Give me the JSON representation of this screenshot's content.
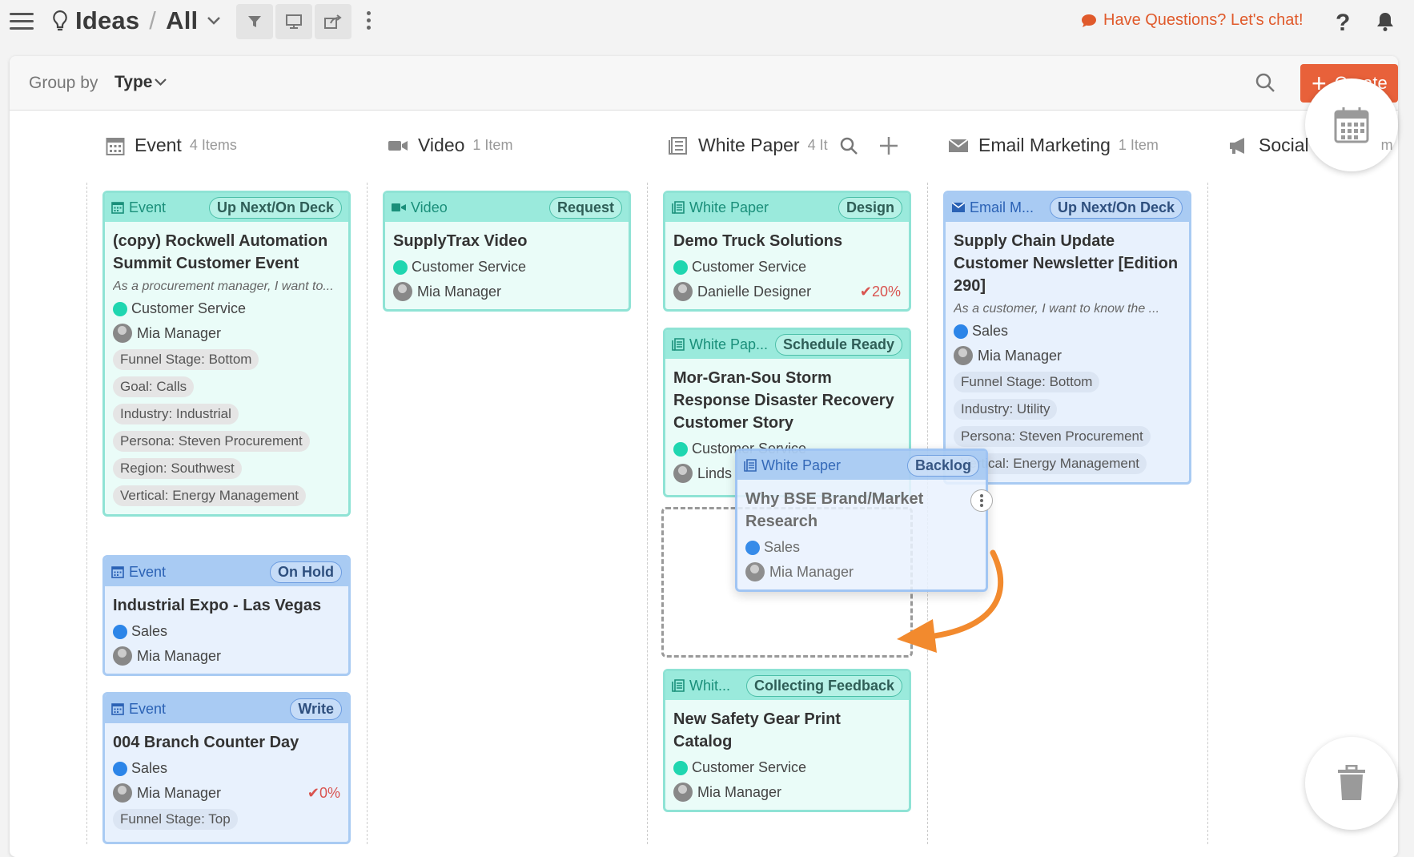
{
  "header": {
    "title": "Ideas",
    "separator": "/",
    "view": "All",
    "chat": "Have Questions? Let's chat!",
    "help": "?"
  },
  "groupbar": {
    "label": "Group by",
    "value": "Type",
    "create": "Create"
  },
  "columns": [
    {
      "name": "Event",
      "count": "4 Items"
    },
    {
      "name": "Video",
      "count": "1 Item"
    },
    {
      "name": "White Paper",
      "count": "4 It"
    },
    {
      "name": "Email Marketing",
      "count": "1 Item"
    },
    {
      "name": "Social",
      "count": "m"
    }
  ],
  "cards": {
    "e1": {
      "type": "Event",
      "status": "Up Next/On Deck",
      "title": "(copy) Rockwell Automation Summit Customer Event",
      "desc": "As a procurement manager, I want to...",
      "tag": "Customer Service",
      "owner": "Mia Manager",
      "chips": [
        "Funnel Stage: Bottom",
        "Goal: Calls",
        "Industry: Industrial",
        "Persona: Steven Procurement",
        "Region: Southwest",
        "Vertical: Energy Management"
      ]
    },
    "e2": {
      "type": "Event",
      "status": "On Hold",
      "title": "Industrial Expo - Las Vegas",
      "tag": "Sales",
      "owner": "Mia Manager"
    },
    "e3": {
      "type": "Event",
      "status": "Write",
      "title": "004 Branch Counter Day",
      "tag": "Sales",
      "owner": "Mia Manager",
      "pct": "0%",
      "chips": [
        "Funnel Stage: Top"
      ]
    },
    "v1": {
      "type": "Video",
      "status": "Request",
      "title": "SupplyTrax Video",
      "tag": "Customer Service",
      "owner": "Mia Manager"
    },
    "w1": {
      "type": "White Paper",
      "status": "Design",
      "title": "Demo Truck Solutions",
      "tag": "Customer Service",
      "owner": "Danielle Designer",
      "pct": "20%"
    },
    "w2": {
      "type": "White Pap...",
      "status": "Schedule Ready",
      "title": "Mor-Gran-Sou Storm Response Disaster Recovery Customer Story",
      "tag": "Customer Service",
      "owner": "Linds"
    },
    "w3": {
      "type": "Whit...",
      "status": "Collecting Feedback",
      "title": "New Safety Gear Print Catalog",
      "tag": "Customer Service",
      "owner": "Mia Manager"
    },
    "m1": {
      "type": "Email M...",
      "status": "Up Next/On Deck",
      "title": "Supply Chain Update Customer Newsletter [Edition 290]",
      "desc": "As a customer, I want to know the ...",
      "tag": "Sales",
      "owner": "Mia Manager",
      "chips": [
        "Funnel Stage: Bottom",
        "Industry: Utility",
        "Persona: Steven Procurement",
        "Vertical: Energy Management"
      ]
    },
    "drag": {
      "type": "White Paper",
      "status": "Backlog",
      "title": "Why BSE Brand/Market Research",
      "tag": "Sales",
      "owner": "Mia Manager"
    }
  },
  "colors": {
    "accent": "#e8613a",
    "teal": "#9aeadc",
    "blue": "#a9cbf3",
    "arrow": "#f28a2e"
  }
}
